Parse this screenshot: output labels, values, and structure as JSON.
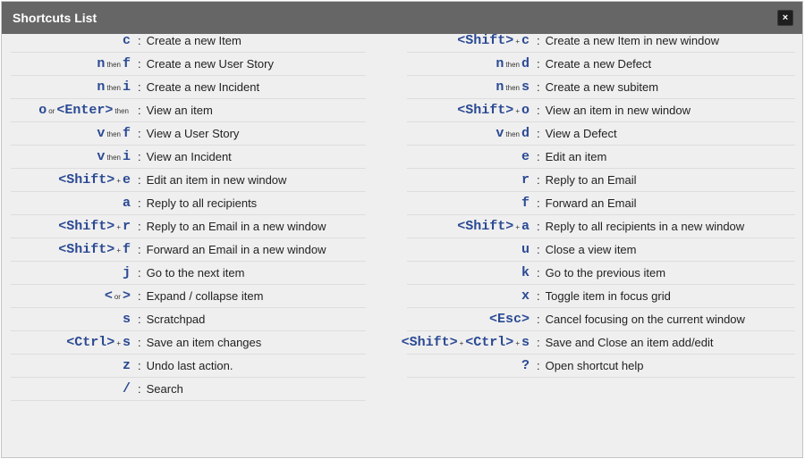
{
  "window": {
    "title": "Shortcuts List",
    "close_symbol": "×"
  },
  "left_column": [
    {
      "keys": [
        {
          "k": "c"
        }
      ],
      "desc": "Create a new Item"
    },
    {
      "keys": [
        {
          "k": "n"
        },
        {
          "s": "then"
        },
        {
          "k": "f"
        }
      ],
      "desc": "Create a new User Story"
    },
    {
      "keys": [
        {
          "k": "n"
        },
        {
          "s": "then"
        },
        {
          "k": "i"
        }
      ],
      "desc": "Create a new Incident"
    },
    {
      "keys": [
        {
          "k": "o"
        },
        {
          "s": "or"
        },
        {
          "k": "<Enter>"
        },
        {
          "s": "then"
        }
      ],
      "desc": "View an item"
    },
    {
      "keys": [
        {
          "k": "v"
        },
        {
          "s": "then"
        },
        {
          "k": "f"
        }
      ],
      "desc": "View a User Story"
    },
    {
      "keys": [
        {
          "k": "v"
        },
        {
          "s": "then"
        },
        {
          "k": "i"
        }
      ],
      "desc": "View an Incident"
    },
    {
      "keys": [
        {
          "k": "<Shift>"
        },
        {
          "s": "+"
        },
        {
          "k": "e"
        }
      ],
      "desc": "Edit an item in new window"
    },
    {
      "keys": [
        {
          "k": "a"
        }
      ],
      "desc": "Reply to all recipients"
    },
    {
      "keys": [
        {
          "k": "<Shift>"
        },
        {
          "s": "+"
        },
        {
          "k": "r"
        }
      ],
      "desc": "Reply to an Email in a new window"
    },
    {
      "keys": [
        {
          "k": "<Shift>"
        },
        {
          "s": "+"
        },
        {
          "k": "f"
        }
      ],
      "desc": "Forward an Email in a new window"
    },
    {
      "keys": [
        {
          "k": "j"
        }
      ],
      "desc": "Go to the next item"
    },
    {
      "keys": [
        {
          "k": "<"
        },
        {
          "s": "or"
        },
        {
          "k": ">"
        }
      ],
      "desc": "Expand / collapse item"
    },
    {
      "keys": [
        {
          "k": "s"
        }
      ],
      "desc": "Scratchpad"
    },
    {
      "keys": [
        {
          "k": "<Ctrl>"
        },
        {
          "s": "+"
        },
        {
          "k": "s"
        }
      ],
      "desc": "Save an item changes"
    },
    {
      "keys": [
        {
          "k": "z"
        }
      ],
      "desc": "Undo last action."
    },
    {
      "keys": [
        {
          "k": "/"
        }
      ],
      "desc": "Search"
    }
  ],
  "right_column": [
    {
      "keys": [
        {
          "k": "<Shift>"
        },
        {
          "s": "+"
        },
        {
          "k": "c"
        }
      ],
      "desc": "Create a new Item in new window"
    },
    {
      "keys": [
        {
          "k": "n"
        },
        {
          "s": "then"
        },
        {
          "k": "d"
        }
      ],
      "desc": "Create a new Defect"
    },
    {
      "keys": [
        {
          "k": "n"
        },
        {
          "s": "then"
        },
        {
          "k": "s"
        }
      ],
      "desc": "Create a new subitem"
    },
    {
      "keys": [
        {
          "k": "<Shift>"
        },
        {
          "s": "+"
        },
        {
          "k": "o"
        }
      ],
      "desc": "View an item in new window"
    },
    {
      "keys": [
        {
          "k": "v"
        },
        {
          "s": "then"
        },
        {
          "k": "d"
        }
      ],
      "desc": "View a Defect"
    },
    {
      "keys": [
        {
          "k": "e"
        }
      ],
      "desc": "Edit an item"
    },
    {
      "keys": [
        {
          "k": "r"
        }
      ],
      "desc": "Reply to an Email"
    },
    {
      "keys": [
        {
          "k": "f"
        }
      ],
      "desc": "Forward an Email"
    },
    {
      "keys": [
        {
          "k": "<Shift>"
        },
        {
          "s": "+"
        },
        {
          "k": "a"
        }
      ],
      "desc": "Reply to all recipients in a new window"
    },
    {
      "keys": [
        {
          "k": "u"
        }
      ],
      "desc": "Close a view item"
    },
    {
      "keys": [
        {
          "k": "k"
        }
      ],
      "desc": "Go to the previous item"
    },
    {
      "keys": [
        {
          "k": "x"
        }
      ],
      "desc": "Toggle item in focus grid"
    },
    {
      "keys": [
        {
          "k": "<Esc>"
        }
      ],
      "desc": "Cancel focusing on the current window"
    },
    {
      "keys": [
        {
          "k": "<Shift>"
        },
        {
          "s": "+"
        },
        {
          "k": "<Ctrl>"
        },
        {
          "s": "+"
        },
        {
          "k": "s"
        }
      ],
      "desc": "Save and Close an item add/edit"
    },
    {
      "keys": [
        {
          "k": "?"
        }
      ],
      "desc": "Open shortcut help"
    }
  ],
  "colors": {
    "key": "#2b4a94",
    "titlebar": "#666666",
    "panel": "#efefef"
  }
}
